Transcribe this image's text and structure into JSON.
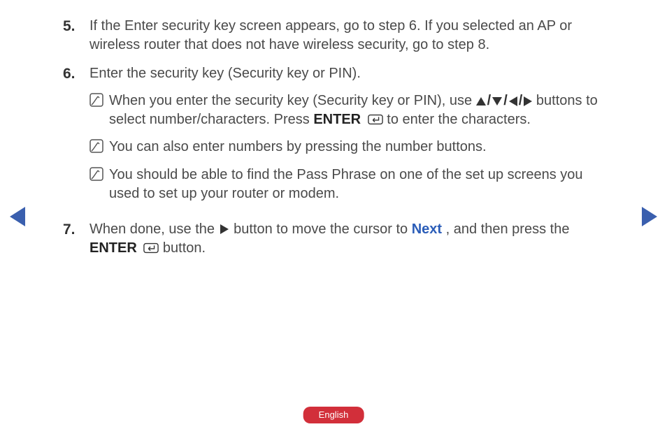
{
  "language_label": "English",
  "steps": {
    "s5": {
      "number": "5.",
      "text": "If the Enter security key screen appears, go to step 6. If you selected an AP or wireless router that does not have wireless security, go to step 8."
    },
    "s6": {
      "number": "6.",
      "text": "Enter the security key (Security key or PIN).",
      "note1_a": "When you enter the security key (Security key or PIN), use ",
      "note1_b": " buttons to select number/characters. Press ",
      "note1_enter": "ENTER",
      "note1_c": " to enter the characters.",
      "note2": "You can also enter numbers by pressing the number buttons.",
      "note3": "You should be able to find the Pass Phrase on one of the set up screens you used to set up your router or modem."
    },
    "s7": {
      "number": "7.",
      "text_a": "When done, use the ",
      "text_b": " button to move the cursor to ",
      "next_label": "Next",
      "text_c": ", and then press the ",
      "enter": "ENTER",
      "text_d": " button."
    }
  }
}
